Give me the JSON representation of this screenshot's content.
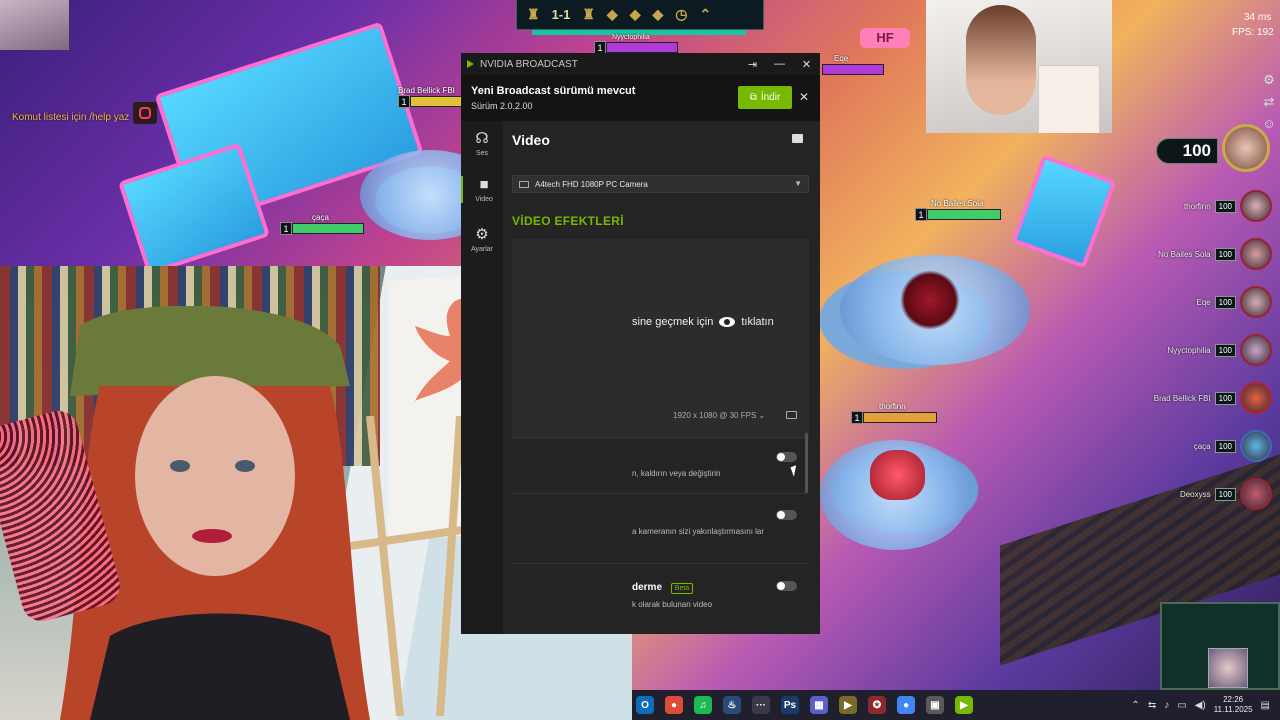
{
  "game": {
    "score": "1-1",
    "ping": "34 ms",
    "fps": "FPS: 192",
    "gold": "100",
    "command_text": "Komut listesi için /help yaz",
    "billboard_sign": "HF",
    "nameplates": [
      {
        "name": "Brad Bellick FBI",
        "level": "1"
      },
      {
        "name": "çaça",
        "level": "1"
      },
      {
        "name": "Eqe",
        "level": ""
      },
      {
        "name": "No Bailes Sola",
        "level": "1"
      },
      {
        "name": "thorfinn",
        "level": "1"
      },
      {
        "name": "Nyyctophilia",
        "level": "1"
      }
    ],
    "players": [
      {
        "name": "thorfinn",
        "hp": "100"
      },
      {
        "name": "No Bailes Sola",
        "hp": "100"
      },
      {
        "name": "Eqe",
        "hp": "100"
      },
      {
        "name": "Nyyctophilia",
        "hp": "100"
      },
      {
        "name": "Brad Bellick FBI",
        "hp": "100"
      },
      {
        "name": "çaça",
        "hp": "100"
      },
      {
        "name": "Deoxyss",
        "hp": "100"
      }
    ]
  },
  "nvidia": {
    "window_title": "NVIDIA BROADCAST",
    "update_title": "Yeni Broadcast sürümü mevcut",
    "update_version": "Sürüm 2.0.2.00",
    "update_button": "İndir",
    "nav": [
      {
        "label": "Ses",
        "icon": "headset-icon"
      },
      {
        "label": "Video",
        "icon": "camera-icon"
      },
      {
        "label": "Ayarlar",
        "icon": "gear-icon"
      }
    ],
    "section_title": "Video",
    "camera_device": "A4tech FHD 1080P PC Camera",
    "effects_title": "VİDEO EFEKTLERİ",
    "preview_text_before": "sine geçmek için",
    "preview_text_after": "tıklatın",
    "resolution": "1920 x 1080 @ 30 FPS",
    "effects": [
      {
        "name": "",
        "desc": "n, kaldırın veya değiştirin",
        "beta": ""
      },
      {
        "name": "",
        "desc": "a kameranın sizi yakınlaştırmasını lar",
        "beta": ""
      },
      {
        "name": "derme",
        "desc": "k olarak bulunan video",
        "beta": "Beta"
      }
    ],
    "accent": "#76b900"
  },
  "taskbar": {
    "apps": [
      "O",
      "●",
      "♫",
      "♨",
      "···",
      "Ps",
      "▦",
      "▶",
      "✪",
      "●",
      "▣",
      "▶"
    ],
    "time": "22:26",
    "date": "11.11.2025"
  }
}
